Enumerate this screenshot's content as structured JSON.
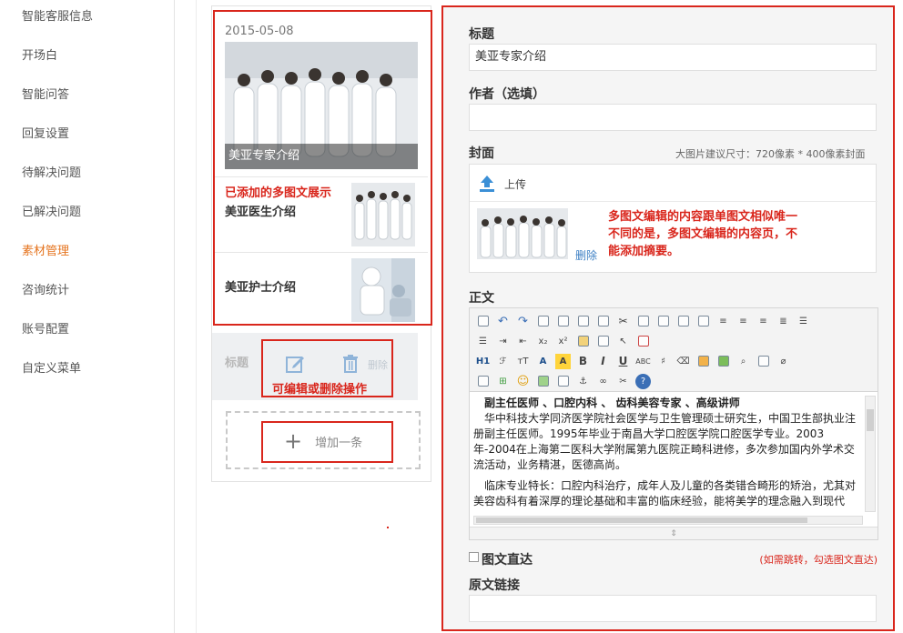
{
  "sidebar": {
    "items": [
      {
        "label": "智能客服信息"
      },
      {
        "label": "开场白"
      },
      {
        "label": "智能问答"
      },
      {
        "label": "回复设置"
      },
      {
        "label": "待解决问题"
      },
      {
        "label": "已解决问题"
      },
      {
        "label": "素材管理"
      },
      {
        "label": "咨询统计"
      },
      {
        "label": "账号配置"
      },
      {
        "label": "自定义菜单"
      }
    ],
    "active_index": 6,
    "active_color": "#e5741f"
  },
  "preview": {
    "date": "2015-05-08",
    "cover_title": "美亚专家介绍",
    "added_note": "已添加的多图文展示",
    "items": [
      {
        "title": "美亚医生介绍"
      },
      {
        "title": "美亚护士介绍"
      }
    ],
    "edit_placeholder_title": "标题",
    "edit_note": "可编辑或删除操作",
    "delete_label": "删除",
    "add_label": "增加一条"
  },
  "editor": {
    "title_label": "标题",
    "title_value": "美亚专家介绍",
    "author_label": "作者（选填）",
    "author_value": "",
    "cover_label": "封面",
    "cover_hint": "大图片建议尺寸：720像素 * 400像素封面",
    "upload_label": "上传",
    "delete_link": "删除",
    "cover_note": "多图文编辑的内容跟单图文相似唯一不同的是，多图文编辑的内容页，不能添加摘要。",
    "body_label": "正文",
    "body": {
      "lead": "副主任医师 、口腔内科 、 齿科美容专家 、高级讲师",
      "p1": "华中科技大学同济医学院社会医学与卫生管理硕士研究生，中国卫生部执业注册副主任医师。1995年毕业于南昌大学口腔医学院口腔医学专业。2003年-2004在上海第二医科大学附属第九医院正畸科进修，多次参加国内外学术交流活动，业务精湛，医德高尚。",
      "p2": "临床专业特长：口腔内科治疗，成年人及儿童的各类错合畸形的矫治，尤其对美容齿科有着深厚的理论基础和丰富的临床经验，能将美学的理念融入到现代"
    },
    "toolbar_labels": {
      "h1": "H1",
      "font": "ℱ",
      "size": "тT",
      "color": "A",
      "bold": "B",
      "italic": "I",
      "underline": "U",
      "strike": "ABC",
      "sub": "x₂",
      "sup": "x²"
    },
    "checkbox_label": "图文直达",
    "checkbox_hint": "(如需跳转，勾选图文直达)",
    "source_label": "原文链接",
    "source_value": ""
  },
  "colors": {
    "accent_red": "#d9261c",
    "link_blue": "#3c7fc4"
  }
}
